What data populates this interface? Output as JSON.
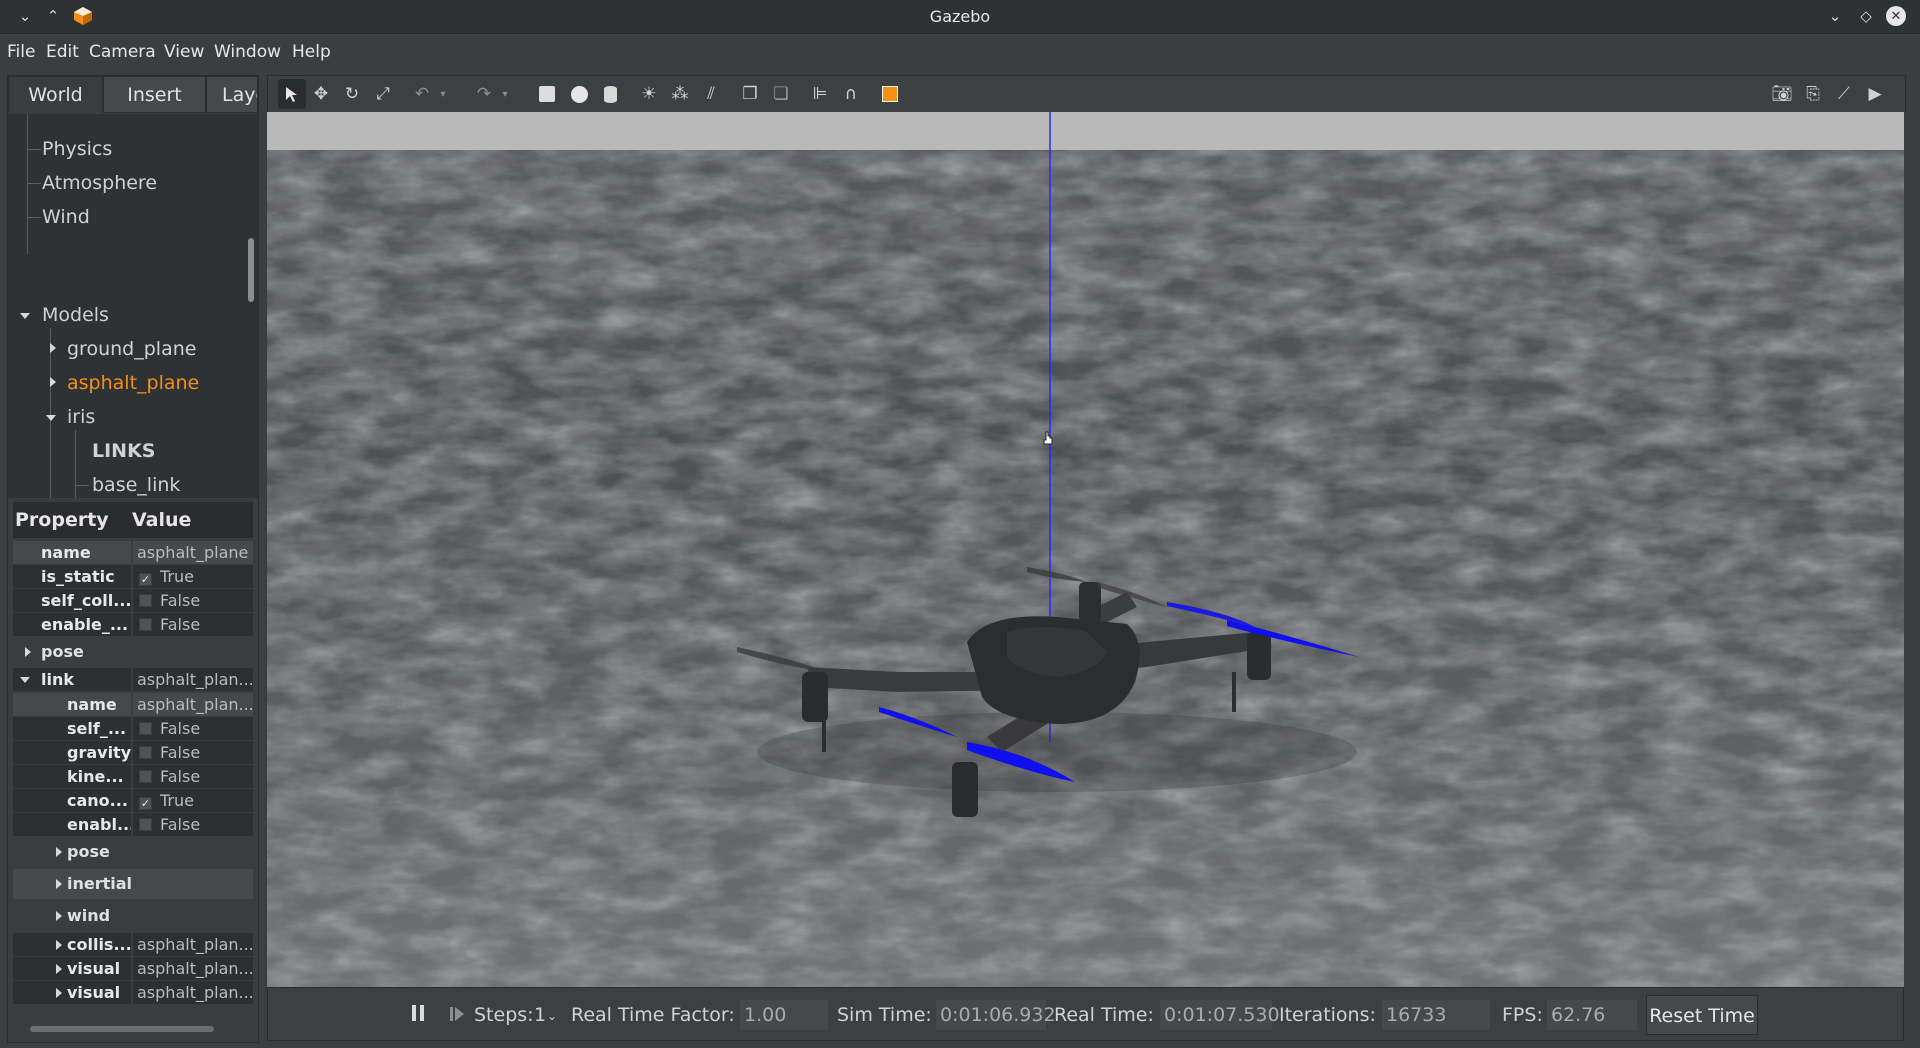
{
  "window": {
    "title": "Gazebo"
  },
  "menu": [
    "File",
    "Edit",
    "Camera",
    "View",
    "Window",
    "Help"
  ],
  "tabs": [
    "World",
    "Insert",
    "Laye"
  ],
  "tree": {
    "physics": "Physics",
    "atmosphere": "Atmosphere",
    "wind": "Wind",
    "models": "Models",
    "ground_plane": "ground_plane",
    "asphalt_plane": "asphalt_plane",
    "iris": "iris",
    "links": "LINKS",
    "base_link": "base_link"
  },
  "props": {
    "header_property": "Property",
    "header_value": "Value",
    "rows": [
      {
        "key": "name",
        "value": "asphalt_plane"
      },
      {
        "key": "is_static",
        "value": "True",
        "check": "✓"
      },
      {
        "key": "self_coll...",
        "value": "False"
      },
      {
        "key": "enable_...",
        "value": "False"
      }
    ],
    "pose": "pose",
    "link": "link",
    "link_value": "asphalt_plan...",
    "link_rows": [
      {
        "key": "name",
        "value": "asphalt_plan..."
      },
      {
        "key": "self_...",
        "value": "False"
      },
      {
        "key": "gravity",
        "value": "False"
      },
      {
        "key": "kine...",
        "value": "False"
      },
      {
        "key": "cano...",
        "value": "True",
        "check": "✓"
      },
      {
        "key": "enabl...",
        "value": "False"
      }
    ],
    "link_pose": "pose",
    "inertial": "inertial",
    "wind": "wind",
    "tail_rows": [
      {
        "key": "collis...",
        "value": "asphalt_plan..."
      },
      {
        "key": "visual",
        "value": "asphalt_plan..."
      },
      {
        "key": "visual",
        "value": "asphalt_plan..."
      }
    ]
  },
  "hud": {
    "steps_label": "Steps:",
    "steps_value": "1",
    "rtf_label": "Real Time Factor:",
    "rtf_value": "1.00",
    "sim_label": "Sim Time:",
    "sim_value": "0:01:06.932",
    "real_label": "Real Time:",
    "real_value": "0:01:07.530",
    "iter_label": "Iterations:",
    "iter_value": "16733",
    "fps_label": "FPS:",
    "fps_value": "62.76",
    "reset": "Reset Time"
  },
  "colors": {
    "selected": "#f39014",
    "propeller": "#1010e0",
    "axis": "#2020ff"
  }
}
